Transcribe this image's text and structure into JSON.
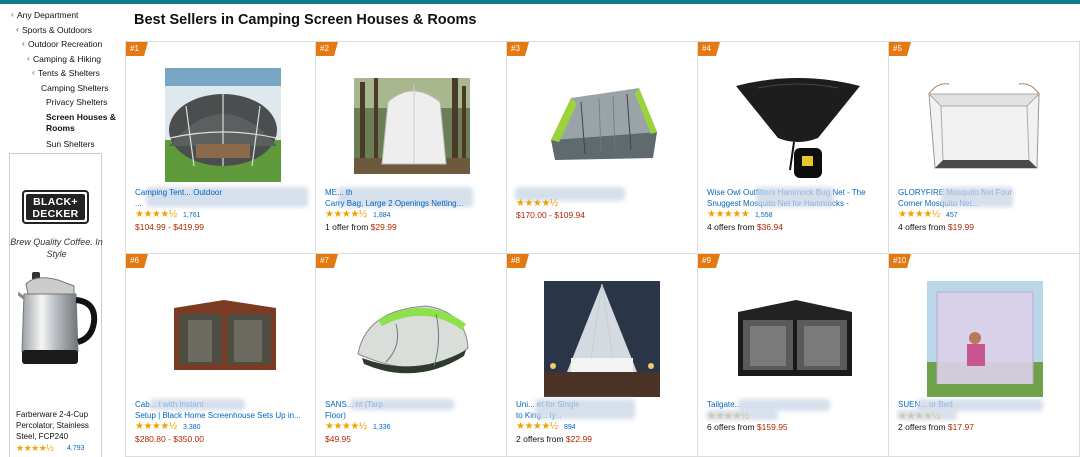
{
  "page": {
    "title": "Best Sellers in Camping Screen Houses & Rooms"
  },
  "sidebar": {
    "categories": [
      {
        "label": "Any Department",
        "chevron": "‹"
      },
      {
        "label": "Sports & Outdoors",
        "chevron": "‹"
      },
      {
        "label": "Outdoor Recreation",
        "chevron": "‹"
      },
      {
        "label": "Camping & Hiking",
        "chevron": "‹"
      },
      {
        "label": "Tents & Shelters",
        "chevron": "‹"
      },
      {
        "label": "Camping Shelters"
      },
      {
        "label": "Privacy Shelters"
      },
      {
        "label": "Screen Houses & Rooms",
        "selected": true
      },
      {
        "label": "Sun Shelters"
      }
    ]
  },
  "ad": {
    "brand": "BLACK+DECKER",
    "brand_line1": "BLACK+",
    "brand_line2": "DECKER",
    "tagline": "Brew Quality Coffee. In Style",
    "product_title": "Farberware 2-4-Cup Percolator, Stainless Steel, FCP240",
    "stars": "★★★★½",
    "review_count": "4,793"
  },
  "products": [
    {
      "rank": "#1",
      "title_visible": "Camping Tent...  Outdoor",
      "title_line2": "...",
      "stars": "★★★★½",
      "reviews": "1,761",
      "price_prefix": "",
      "price": "$104.99 - $419.99"
    },
    {
      "rank": "#2",
      "title_visible": "ME...                                th",
      "title_line2": "Carry Bag, Large 2 Openings Netting...",
      "stars": "★★★★½",
      "reviews": "1,884",
      "price_prefix": "1 offer from ",
      "price": "$29.99"
    },
    {
      "rank": "#3",
      "title_visible": "",
      "title_line2": "",
      "stars": "★★★★½",
      "reviews": "",
      "price_prefix": "",
      "price": "$170.00 - $109.94"
    },
    {
      "rank": "#4",
      "title_visible": "Wise Owl Outfitters Hammock Bug Net - The",
      "title_line2": "Snuggest Mosquito Net for Hammocks - Premium...",
      "stars": "★★★★★",
      "reviews": "1,558",
      "price_prefix": "4 offers from ",
      "price": "$36.94"
    },
    {
      "rank": "#5",
      "title_visible": "GLORYFIRE                Mosquito Net Four",
      "title_line2": "Corner                        Mosquito Net...",
      "stars": "★★★★½",
      "reviews": "457",
      "price_prefix": "4 offers from ",
      "price": "$19.99"
    },
    {
      "rank": "#6",
      "title_visible": "Cab...                                   t with Instant",
      "title_line2": "Setup | Black Home Screenhouse Sets Up in...",
      "stars": "★★★★½",
      "reviews": "3,380",
      "price_prefix": "",
      "price": "$280.80 - $350.00"
    },
    {
      "rank": "#7",
      "title_visible": "SANS...                                    nt (Tarp",
      "title_line2": "Floor)",
      "stars": "★★★★½",
      "reviews": "1,336",
      "price_prefix": "",
      "price": "$49.95"
    },
    {
      "rank": "#8",
      "title_visible": "Uni...                                  et for Single",
      "title_line2": "to King...                                     ly...",
      "stars": "★★★★½",
      "reviews": "894",
      "price_prefix": "2 offers from ",
      "price": "$22.99"
    },
    {
      "rank": "#9",
      "title_visible": "Tailgate...",
      "title_line2": "",
      "stars": "★★★★½",
      "reviews": "",
      "price_prefix": "6 offers from ",
      "price": "$159.95"
    },
    {
      "rank": "#10",
      "title_visible": "SUEN...                                    or Bed",
      "title_line2": "",
      "stars": "★★★★½",
      "reviews": "",
      "price_prefix": "2 offers from ",
      "price": "$17.97"
    }
  ],
  "colors": {
    "accent_bar": "#0f7c8c",
    "rank_badge": "#e47911",
    "link": "#0066c0",
    "price": "#b12704",
    "star": "#f0a300"
  }
}
